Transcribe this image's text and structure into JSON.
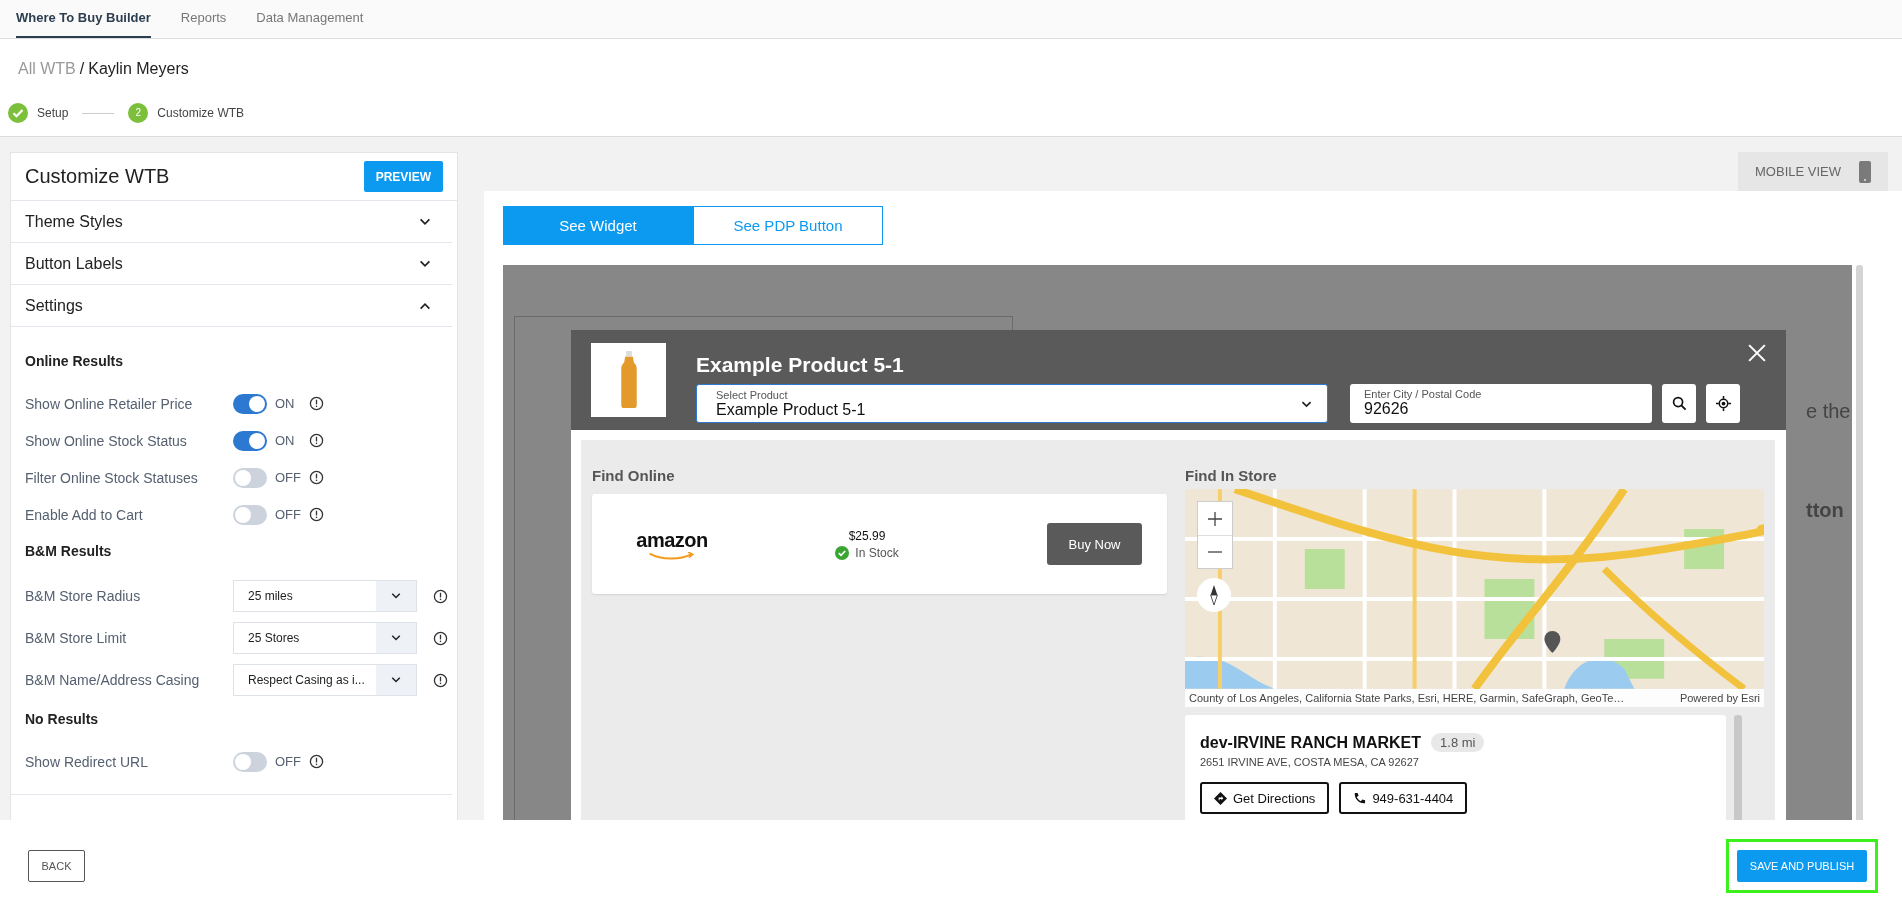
{
  "nav": {
    "tabs": [
      {
        "label": "Where To Buy Builder",
        "selected": true
      },
      {
        "label": "Reports",
        "selected": false
      },
      {
        "label": "Data Management",
        "selected": false
      }
    ]
  },
  "breadcrumb": {
    "parent": "All WTB",
    "separator": "/",
    "current": "Kaylin Meyers"
  },
  "stepper": [
    {
      "label": "Setup",
      "done": true
    },
    {
      "label": "Customize WTB",
      "done": false,
      "number": "2"
    }
  ],
  "panel": {
    "title": "Customize WTB",
    "preview_button": "PREVIEW",
    "sections": [
      {
        "label": "Theme Styles",
        "expanded": false
      },
      {
        "label": "Button Labels",
        "expanded": false
      },
      {
        "label": "Settings",
        "expanded": true,
        "groups": [
          {
            "heading": "Online Results",
            "settings": [
              {
                "kind": "toggle",
                "label": "Show Online Retailer Price",
                "on": true,
                "state_text": "ON"
              },
              {
                "kind": "toggle",
                "label": "Show Online Stock Status",
                "on": true,
                "state_text": "ON"
              },
              {
                "kind": "toggle",
                "label": "Filter Online Stock Statuses",
                "on": false,
                "state_text": "OFF"
              },
              {
                "kind": "toggle",
                "label": "Enable Add to Cart",
                "on": false,
                "state_text": "OFF"
              }
            ]
          },
          {
            "heading": "B&M Results",
            "settings": [
              {
                "kind": "select",
                "label": "B&M Store Radius",
                "value": "25 miles"
              },
              {
                "kind": "select",
                "label": "B&M Store Limit",
                "value": "25 Stores"
              },
              {
                "kind": "select",
                "label": "B&M Name/Address Casing",
                "value": "Respect Casing as i..."
              }
            ]
          },
          {
            "heading": "No Results",
            "settings": [
              {
                "kind": "toggle",
                "label": "Show Redirect URL",
                "on": false,
                "state_text": "OFF"
              }
            ]
          }
        ]
      }
    ]
  },
  "mobile_view_button": "MOBILE VIEW",
  "view_tabs": [
    {
      "label": "See Widget",
      "selected": true
    },
    {
      "label": "See PDP Button",
      "selected": false
    }
  ],
  "preview": {
    "background_texts": [
      "e the",
      "tton"
    ],
    "widget": {
      "title": "Example Product 5-1",
      "product_select": {
        "label": "Select Product",
        "value": "Example Product 5-1"
      },
      "location_field": {
        "label": "Enter City / Postal Code",
        "value": "92626"
      },
      "online": {
        "heading": "Find Online",
        "retailers": [
          {
            "retailer": "amazon",
            "price": "$25.99",
            "stock": "In Stock",
            "in_stock": true,
            "button": "Buy Now"
          }
        ]
      },
      "store": {
        "heading": "Find In Store",
        "attribution": "County of Los Angeles, California State Parks, Esri, HERE, Garmin, SafeGraph, GeoTe…",
        "powered_by": "Powered by Esri",
        "stores": [
          {
            "name": "dev-IRVINE RANCH MARKET",
            "distance": "1.8 mi",
            "address": "2651 IRVINE AVE, COSTA MESA, CA 92627",
            "directions_button": "Get Directions",
            "phone_button": "949-631-4404"
          }
        ]
      }
    }
  },
  "footer": {
    "back_button": "BACK",
    "save_button": {
      "label": "SAVE AND PUBLISH",
      "highlighted": true
    }
  }
}
